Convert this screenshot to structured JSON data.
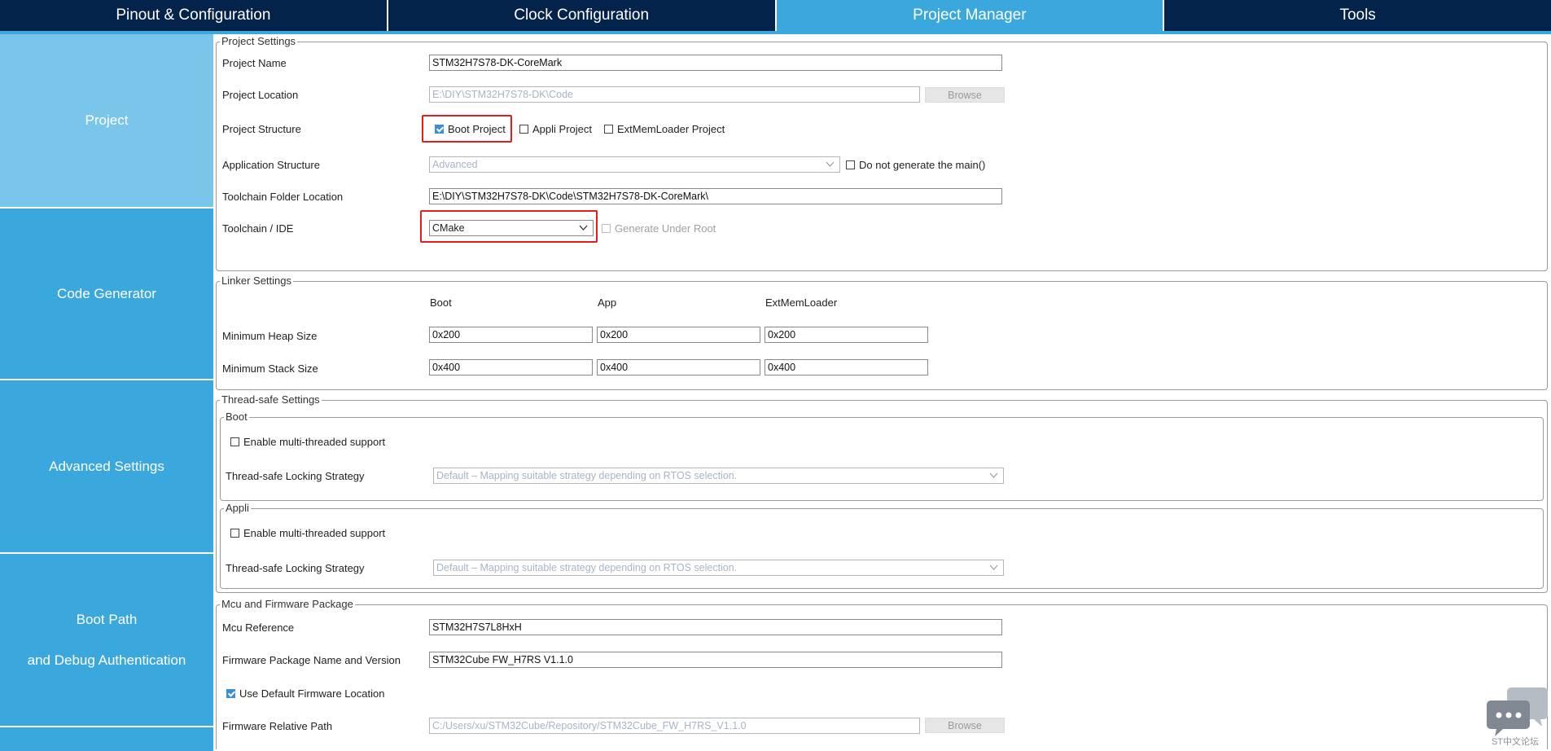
{
  "tabs": [
    {
      "label": "Pinout & Configuration"
    },
    {
      "label": "Clock Configuration"
    },
    {
      "label": "Project Manager"
    },
    {
      "label": "Tools"
    }
  ],
  "sidebar": {
    "project": "Project",
    "code_generator": "Code Generator",
    "advanced_settings": "Advanced Settings",
    "boot_path_line1": "Boot Path",
    "boot_path_line2": "and Debug Authentication"
  },
  "project_settings": {
    "legend": "Project Settings",
    "project_name_label": "Project Name",
    "project_name_value": "STM32H7S78-DK-CoreMark",
    "project_location_label": "Project Location",
    "project_location_value": "E:\\DIY\\STM32H7S78-DK\\Code",
    "browse_label": "Browse",
    "project_structure_label": "Project Structure",
    "boot_project": "Boot Project",
    "appli_project": "Appli Project",
    "extmem_project": "ExtMemLoader Project",
    "application_structure_label": "Application Structure",
    "application_structure_value": "Advanced",
    "do_not_generate_main": "Do not generate the main()",
    "toolchain_folder_label": "Toolchain Folder Location",
    "toolchain_folder_value": "E:\\DIY\\STM32H7S78-DK\\Code\\STM32H7S78-DK-CoreMark\\",
    "toolchain_ide_label": "Toolchain / IDE",
    "toolchain_ide_value": "CMake",
    "generate_under_root": "Generate Under Root"
  },
  "linker_settings": {
    "legend": "Linker Settings",
    "col_boot": "Boot",
    "col_app": "App",
    "col_extmem": "ExtMemLoader",
    "min_heap_label": "Minimum Heap Size",
    "min_stack_label": "Minimum Stack Size",
    "heap_boot": "0x200",
    "heap_app": "0x200",
    "heap_extmem": "0x200",
    "stack_boot": "0x400",
    "stack_app": "0x400",
    "stack_extmem": "0x400"
  },
  "thread_safe": {
    "legend": "Thread-safe Settings",
    "boot_legend": "Boot",
    "appli_legend": "Appli",
    "enable_multithread": "Enable multi-threaded support",
    "locking_strategy_label": "Thread-safe Locking Strategy",
    "locking_strategy_value": "Default  –  Mapping suitable strategy depending on RTOS selection."
  },
  "mcu_firmware": {
    "legend": "Mcu and Firmware Package",
    "mcu_reference_label": "Mcu Reference",
    "mcu_reference_value": "STM32H7S7L8HxH",
    "fw_package_label": "Firmware Package Name and Version",
    "fw_package_value": "STM32Cube FW_H7RS V1.1.0",
    "use_default_fw_location": "Use Default Firmware Location",
    "fw_relative_path_label": "Firmware Relative Path",
    "fw_relative_path_value": "C:/Users/xu/STM32Cube/Repository/STM32Cube_FW_H7RS_V1.1.0",
    "browse_label": "Browse"
  },
  "watermark": {
    "text": "ST中文论坛"
  }
}
